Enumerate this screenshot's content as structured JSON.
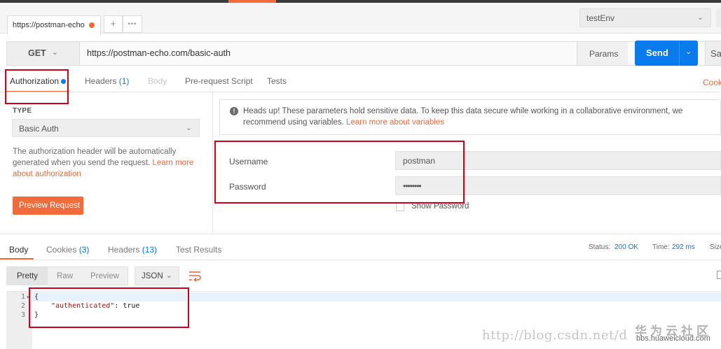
{
  "tabs": {
    "active_tab_title": "https://postman-echo",
    "add_tab": "+",
    "more_tabs": "•••"
  },
  "environment": {
    "selected": "testEnv"
  },
  "request": {
    "method": "GET",
    "url": "https://postman-echo.com/basic-auth",
    "params_label": "Params",
    "send_label": "Send",
    "save_label": "Sav"
  },
  "request_tabs": [
    {
      "label": "Authorization",
      "count": ""
    },
    {
      "label": "Headers",
      "count": "(1)"
    },
    {
      "label": "Body",
      "count": ""
    },
    {
      "label": "Pre-request Script",
      "count": ""
    },
    {
      "label": "Tests",
      "count": ""
    }
  ],
  "cookies_link": "Cook",
  "auth": {
    "type_heading": "TYPE",
    "type_value": "Basic Auth",
    "help_text": "The authorization header will be automatically generated when you send the request.",
    "help_link": "Learn more about authorization",
    "preview_button": "Preview Request",
    "notice_text": "Heads up! These parameters hold sensitive data. To keep this data secure while working in a collaborative environment, we recommend using variables.",
    "notice_link": "Learn more about variables",
    "username_label": "Username",
    "username_value": "postman",
    "password_label": "Password",
    "password_value": "••••••••",
    "show_password_label": "Show Password"
  },
  "response_tabs": [
    {
      "label": "Body",
      "count": ""
    },
    {
      "label": "Cookies",
      "count": "(3)"
    },
    {
      "label": "Headers",
      "count": "(13)"
    },
    {
      "label": "Test Results",
      "count": ""
    }
  ],
  "response_status": {
    "status_label": "Status:",
    "status_value": "200 OK",
    "time_label": "Time:",
    "time_value": "292 ms",
    "size_label": "Size"
  },
  "response_view": {
    "formats": [
      "Pretty",
      "Raw",
      "Preview"
    ],
    "language": "JSON"
  },
  "response_body": {
    "line_numbers": [
      "1",
      "2",
      "3"
    ],
    "line1": "{",
    "key": "\"authenticated\"",
    "separator": ": ",
    "value": "true",
    "line3": "}"
  },
  "watermark": {
    "url": "http://blog.csdn.net/d",
    "brand_cn": "华为云社区",
    "brand_site": "bbs.huaweicloud.com"
  },
  "colors": {
    "accent_orange": "#f26b3a",
    "primary_blue": "#097bed",
    "annotation_red": "#d0021b"
  }
}
